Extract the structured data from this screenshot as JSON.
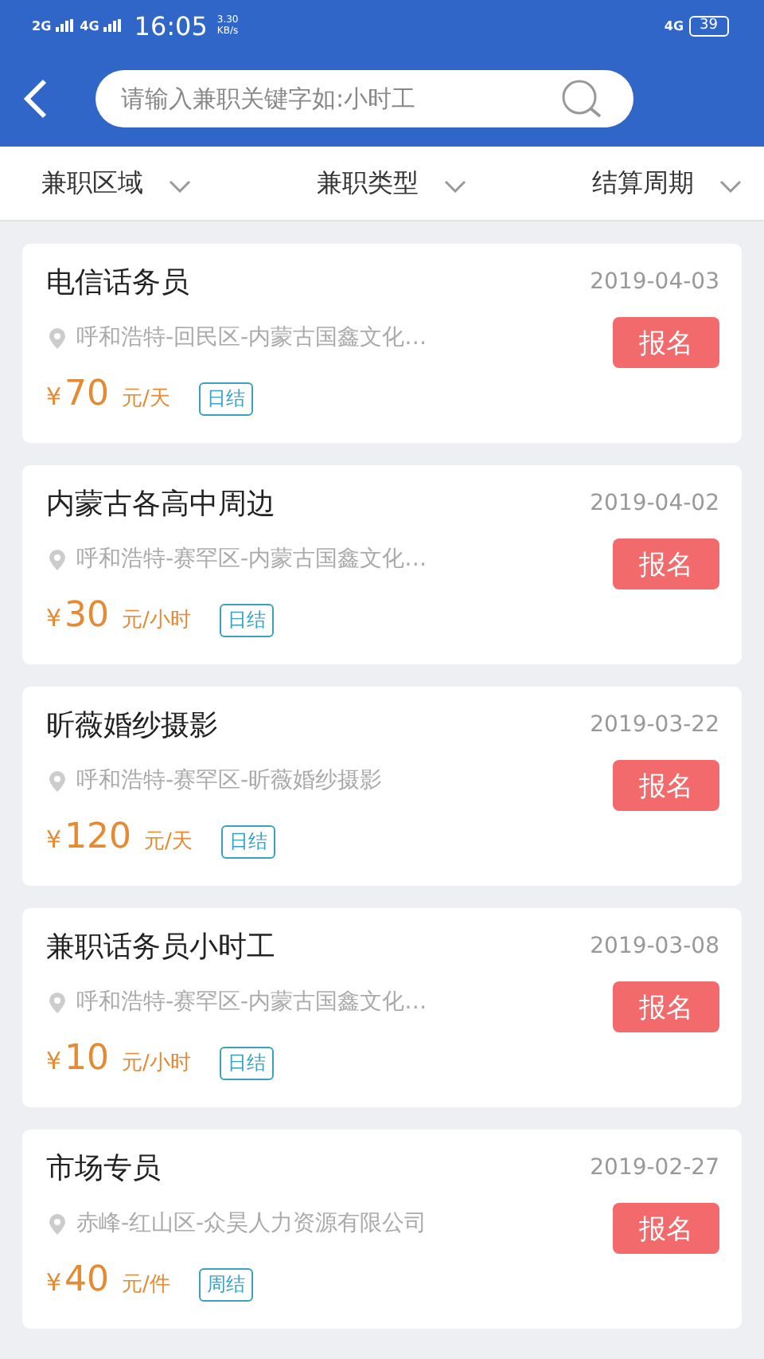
{
  "status_bar": {
    "network_1": "2G",
    "network_2": "4G",
    "time": "16:05",
    "speed_value": "3.30",
    "speed_unit": "KB/s",
    "network_right": "4G",
    "battery": "39"
  },
  "search": {
    "placeholder": "请输入兼职关键字如:小时工"
  },
  "filters": [
    {
      "label": "兼职区域"
    },
    {
      "label": "兼职类型"
    },
    {
      "label": "结算周期"
    }
  ],
  "jobs": [
    {
      "title": "电信话务员",
      "date": "2019-04-03",
      "location": "呼和浩特-回民区-内蒙古国鑫文化…",
      "button": "报名",
      "currency": "¥",
      "amount": "70",
      "unit": "元/天",
      "tag": "日结"
    },
    {
      "title": "内蒙古各高中周边",
      "date": "2019-04-02",
      "location": "呼和浩特-赛罕区-内蒙古国鑫文化…",
      "button": "报名",
      "currency": "¥",
      "amount": "30",
      "unit": "元/小时",
      "tag": "日结"
    },
    {
      "title": "昕薇婚纱摄影",
      "date": "2019-03-22",
      "location": "呼和浩特-赛罕区-昕薇婚纱摄影",
      "button": "报名",
      "currency": "¥",
      "amount": "120",
      "unit": "元/天",
      "tag": "日结"
    },
    {
      "title": "兼职话务员小时工",
      "date": "2019-03-08",
      "location": "呼和浩特-赛罕区-内蒙古国鑫文化…",
      "button": "报名",
      "currency": "¥",
      "amount": "10",
      "unit": "元/小时",
      "tag": "日结"
    },
    {
      "title": "市场专员",
      "date": "2019-02-27",
      "location": "赤峰-红山区-众昊人力资源有限公司",
      "button": "报名",
      "currency": "¥",
      "amount": "40",
      "unit": "元/件",
      "tag": "周结"
    }
  ]
}
